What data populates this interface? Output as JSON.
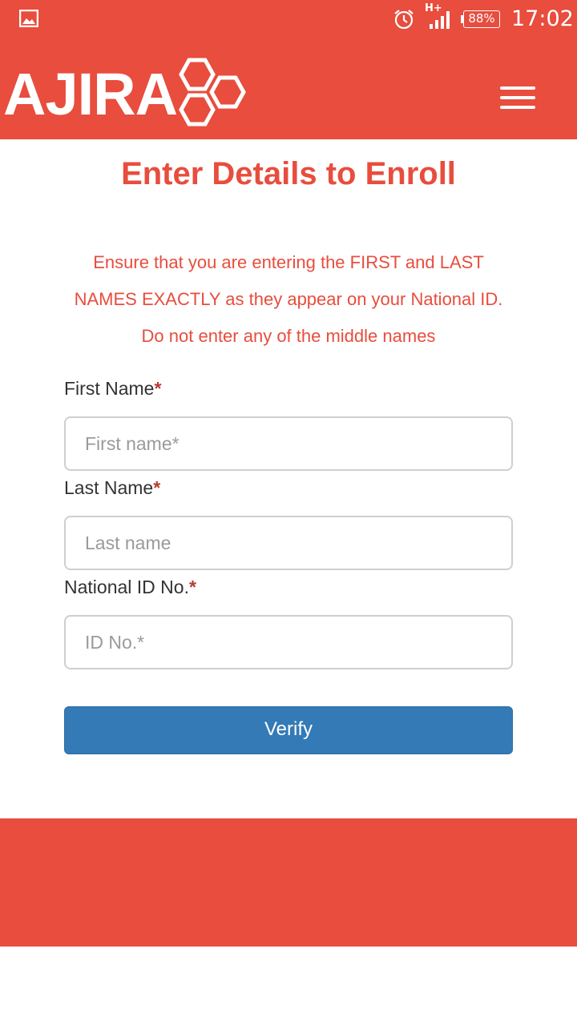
{
  "status_bar": {
    "network": "H+",
    "battery": "88%",
    "time": "17:02",
    "icons": [
      "gallery-icon",
      "alarm-icon",
      "signal-icon",
      "battery-icon"
    ]
  },
  "header": {
    "logo_text": "AJIRA",
    "brand_color": "#e84d3d",
    "menu_icon": "hamburger-menu-icon"
  },
  "main": {
    "title": "Enter Details to Enroll",
    "notice_lines": [
      "Ensure that you are entering the FIRST and LAST",
      "NAMES EXACTLY as they appear on your National ID.",
      "Do not enter any of the middle names"
    ],
    "required_marker": "*",
    "fields": [
      {
        "label": "First Name",
        "placeholder": "First name*",
        "value": ""
      },
      {
        "label": "Last Name",
        "placeholder": "Last name",
        "value": ""
      },
      {
        "label": "National ID No.",
        "placeholder": "ID No.*",
        "value": ""
      }
    ],
    "verify_label": "Verify",
    "verify_color": "#337ab7"
  }
}
